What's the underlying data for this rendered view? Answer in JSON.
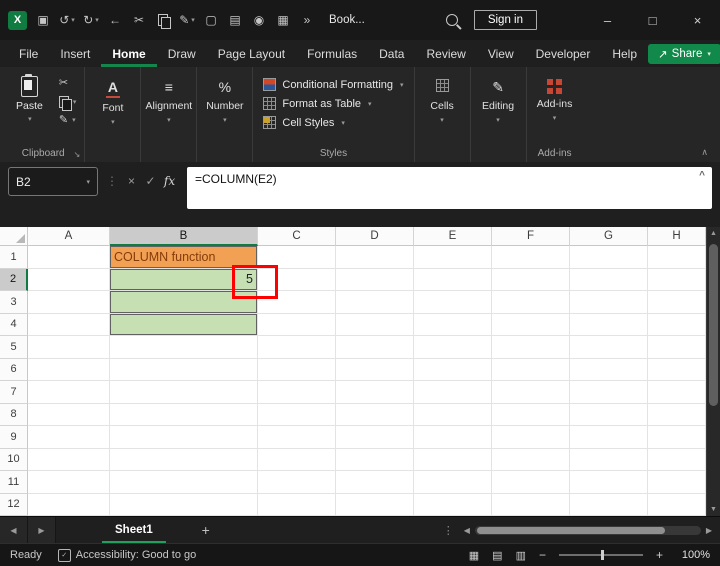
{
  "window": {
    "title": "Book...",
    "sign_in_label": "Sign in"
  },
  "icons": {
    "save": "▣",
    "undo": "↺",
    "redo": "↻",
    "back": "←",
    "cut": "✂",
    "format_painter": "✎",
    "new_file": "▢",
    "print": "▤",
    "camera": "◉",
    "table": "▦",
    "overflow": "»",
    "share": "↗",
    "minimize": "–",
    "maximize": "□",
    "close": "×",
    "dropdown": "▾",
    "cancel": "×",
    "enter": "✓",
    "fx": "fx",
    "dots": "⋮",
    "expand_formula": "^",
    "dialog_launcher": "↘",
    "font": "A",
    "alignment": "≡",
    "number": "%",
    "editing": "✎",
    "collapse_ribbon": "∧",
    "sheet_prev": "◀",
    "sheet_next": "▶",
    "scroll_left": "◀",
    "scroll_right": "▶",
    "scroll_up": "▲",
    "scroll_down": "▼",
    "view_normal": "▦",
    "view_layout": "▤",
    "view_break": "▥",
    "zoom_out": "−",
    "zoom_in": "+",
    "check": "✓"
  },
  "menu": {
    "tabs": [
      {
        "label": "File",
        "active": false
      },
      {
        "label": "Insert",
        "active": false
      },
      {
        "label": "Home",
        "active": true
      },
      {
        "label": "Draw",
        "active": false
      },
      {
        "label": "Page Layout",
        "active": false
      },
      {
        "label": "Formulas",
        "active": false
      },
      {
        "label": "Data",
        "active": false
      },
      {
        "label": "Review",
        "active": false
      },
      {
        "label": "View",
        "active": false
      },
      {
        "label": "Developer",
        "active": false
      },
      {
        "label": "Help",
        "active": false
      }
    ],
    "share_label": "Share"
  },
  "ribbon": {
    "paste_label": "Paste",
    "clipboard_group_label": "Clipboard",
    "font_label": "Font",
    "alignment_label": "Alignment",
    "number_label": "Number",
    "conditional_formatting_label": "Conditional Formatting",
    "format_as_table_label": "Format as Table",
    "cell_styles_label": "Cell Styles",
    "styles_group_label": "Styles",
    "cells_label": "Cells",
    "editing_label": "Editing",
    "addins_label": "Add-ins",
    "addins_group_label": "Add-ins"
  },
  "formula_bar": {
    "name_box": "B2",
    "formula": "=COLUMN(E2)"
  },
  "grid": {
    "columns": [
      "A",
      "B",
      "C",
      "D",
      "E",
      "F",
      "G",
      "H"
    ],
    "rows": [
      "1",
      "2",
      "3",
      "4",
      "5",
      "6",
      "7",
      "8",
      "9",
      "10",
      "11",
      "12"
    ],
    "selected_column": "B",
    "selected_row": "2",
    "cells": [
      {
        "ref": "B1",
        "text": "COLUMN function",
        "bg": "#F2A154",
        "color": "#843C0C",
        "align": "left",
        "bordered": true
      },
      {
        "ref": "B2",
        "text": "5",
        "bg": "#C6E0B4",
        "color": "#1F1F1F",
        "align": "right",
        "bordered": true
      },
      {
        "ref": "B3",
        "text": "",
        "bg": "#C6E0B4",
        "color": "#1F1F1F",
        "align": "left",
        "bordered": true
      },
      {
        "ref": "B4",
        "text": "",
        "bg": "#C6E0B4",
        "color": "#1F1F1F",
        "align": "left",
        "bordered": true
      }
    ],
    "annotation_color": "#FF0000"
  },
  "sheet_bar": {
    "tabs": [
      {
        "label": "Sheet1",
        "active": true
      }
    ],
    "add_sheet": "+"
  },
  "status_bar": {
    "ready_label": "Ready",
    "accessibility_label": "Accessibility: Good to go",
    "zoom_level": "100%"
  },
  "colors": {
    "accent_green": "#107C41",
    "share_green": "#10894A",
    "titlebar_bg": "#181818",
    "ribbon_bg": "#262626",
    "cell_green": "#C6E0B4",
    "cell_orange": "#F2A154",
    "annotation_red": "#FF0000"
  }
}
